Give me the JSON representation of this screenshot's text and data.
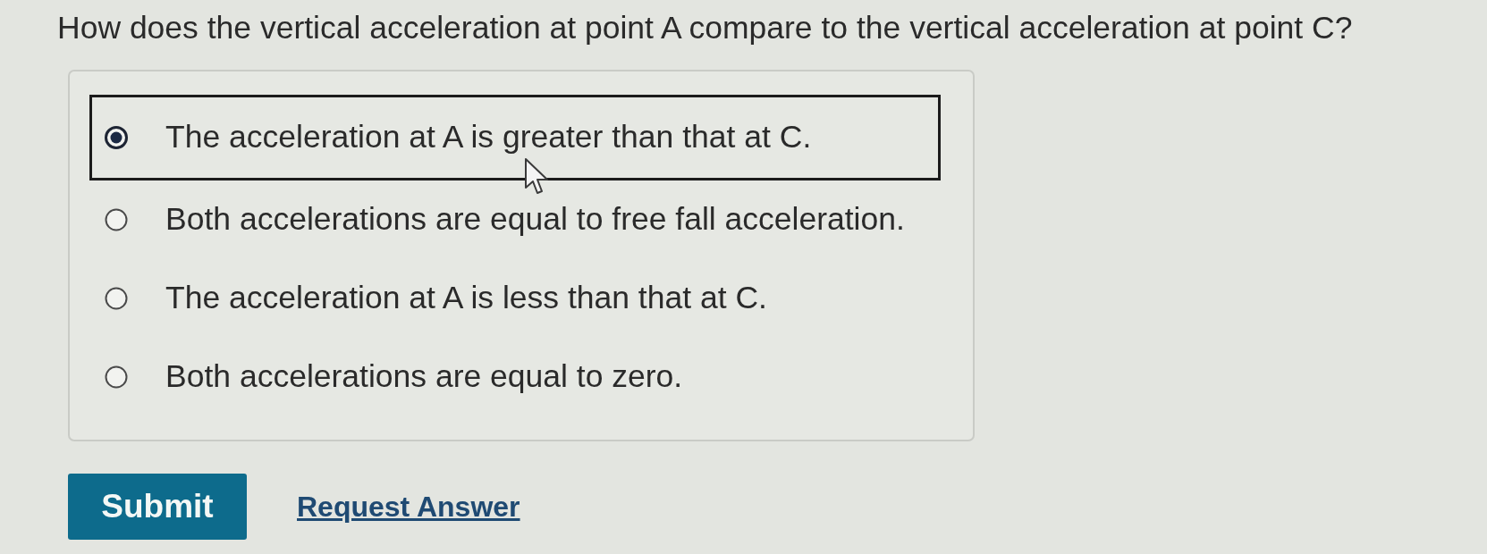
{
  "question": "How does the vertical acceleration at point A compare to the vertical acceleration at point C?",
  "options": [
    {
      "label": "The acceleration at A is greater than that at C.",
      "selected": true
    },
    {
      "label": "Both accelerations are equal to free fall acceleration.",
      "selected": false
    },
    {
      "label": "The acceleration at A is less than that at C.",
      "selected": false
    },
    {
      "label": "Both accelerations are equal to zero.",
      "selected": false
    }
  ],
  "actions": [
    {
      "kind": "button",
      "label": "Submit"
    },
    {
      "kind": "link",
      "label": "Request Answer"
    }
  ]
}
